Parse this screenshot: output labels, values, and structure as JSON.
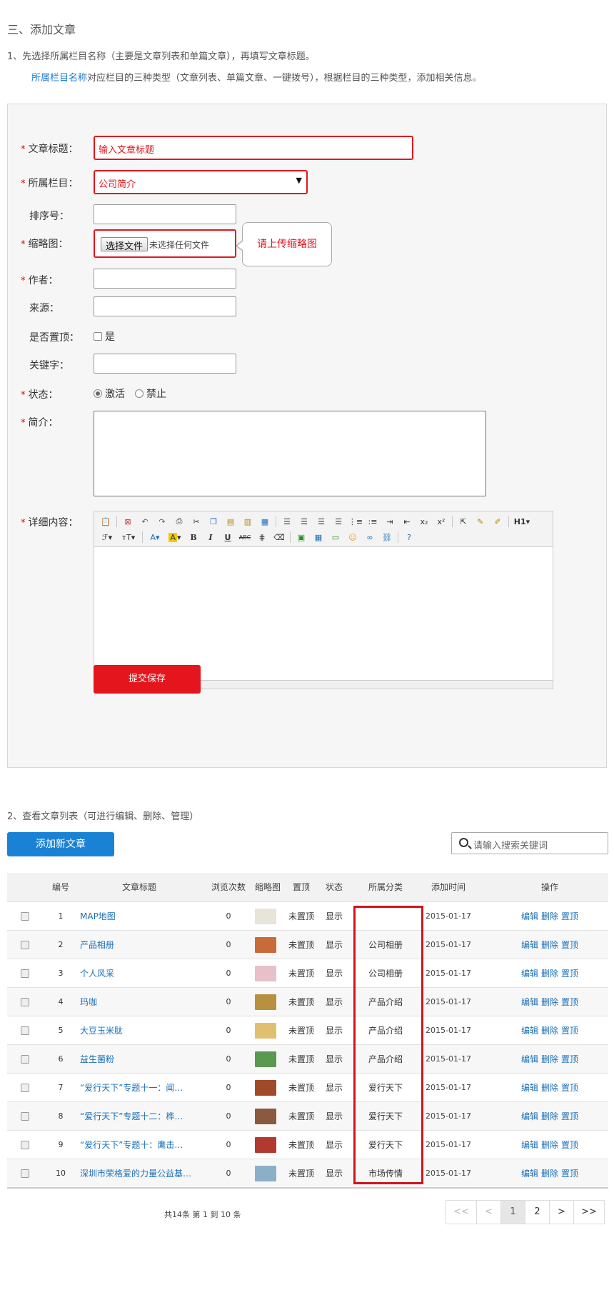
{
  "section_title": "三、添加文章",
  "step1": "1、先选择所属栏目名称（主要是文章列表和单篇文章），再填写文章标题。",
  "step1_note": {
    "highlight": "所属栏目名称",
    "rest": "对应栏目的三种类型（文章列表、单篇文章、一键拨号），根据栏目的三种类型，添加相关信息。"
  },
  "form": {
    "title_label": "文章标题：",
    "title_value": "输入文章标题",
    "column_label": "所属栏目：",
    "column_value": "公司简介",
    "order_label": "排序号：",
    "thumb_label": "缩略图：",
    "file_button": "选择文件",
    "file_status": "未选择任何文件",
    "thumb_tip": "请上传缩略图",
    "author_label": "作者：",
    "source_label": "来源：",
    "top_label": "是否置顶：",
    "top_option": "是",
    "keyword_label": "关键字：",
    "status_label": "状态：",
    "status_options": [
      "激活",
      "禁止"
    ],
    "status_selected": "激活",
    "intro_label": "简介：",
    "detail_label": "详细内容：",
    "submit_label": "提交保存",
    "required_mark": "*"
  },
  "editor": {
    "toolbar_row1": [
      "paste-icon",
      "source-icon",
      "undo-icon",
      "redo-icon",
      "print-icon",
      "cut-icon",
      "copy-icon",
      "paste-text-icon",
      "paste-word-icon",
      "paste-plain-icon",
      "align-left-icon",
      "align-center-icon",
      "align-right-icon",
      "align-justify-icon",
      "ordered-list-icon",
      "unordered-list-icon",
      "indent-icon",
      "outdent-icon",
      "subscript-icon",
      "superscript-icon",
      "select-all-icon",
      "clear-format-icon",
      "quick-format-icon",
      "heading-icon"
    ],
    "toolbar_row2": [
      "font-family-icon",
      "font-size-icon",
      "font-color-icon",
      "highlight-color-icon",
      "bold-icon",
      "italic-icon",
      "underline-icon",
      "strikethrough-icon",
      "line-height-icon",
      "eraser-icon",
      "image-icon",
      "table-icon",
      "hr-icon",
      "emoticon-icon",
      "link-icon",
      "unlink-icon",
      "help-icon"
    ],
    "heading_label": "H1",
    "glyphs": {
      "B": "B",
      "I": "I",
      "U": "U",
      "ABC": "ABC",
      "A": "A",
      "F": "ℱ",
      "T": "тT",
      "sub": "x₂",
      "sup": "x²"
    }
  },
  "step2": "2、查看文章列表（可进行编辑、删除、管理）",
  "add_button": "添加新文章",
  "search": {
    "placeholder": "请输入搜索关键词"
  },
  "table": {
    "headers": [
      "编号",
      "文章标题",
      "浏览次数",
      "缩略图",
      "置顶",
      "状态",
      "所属分类",
      "添加时间",
      "操作"
    ],
    "rows": [
      {
        "id": "1",
        "title": "MAP地图",
        "views": "0",
        "top": "未置顶",
        "status": "显示",
        "category": "",
        "date": "2015-01-17",
        "thumb_color": "#e8e4d8"
      },
      {
        "id": "2",
        "title": "产品相册",
        "views": "0",
        "top": "未置顶",
        "status": "显示",
        "category": "公司相册",
        "date": "2015-01-17",
        "thumb_color": "#c86a3a"
      },
      {
        "id": "3",
        "title": "个人风采",
        "views": "0",
        "top": "未置顶",
        "status": "显示",
        "category": "公司相册",
        "date": "2015-01-17",
        "thumb_color": "#e8c0c8"
      },
      {
        "id": "4",
        "title": "玛咖",
        "views": "0",
        "top": "未置顶",
        "status": "显示",
        "category": "产品介绍",
        "date": "2015-01-17",
        "thumb_color": "#b89040"
      },
      {
        "id": "5",
        "title": "大豆玉米肽",
        "views": "0",
        "top": "未置顶",
        "status": "显示",
        "category": "产品介绍",
        "date": "2015-01-17",
        "thumb_color": "#e0c070"
      },
      {
        "id": "6",
        "title": "益生菌粉",
        "views": "0",
        "top": "未置顶",
        "status": "显示",
        "category": "产品介绍",
        "date": "2015-01-17",
        "thumb_color": "#5a9a50"
      },
      {
        "id": "7",
        "title": "“爱行天下”专题十一：闻…",
        "views": "0",
        "top": "未置顶",
        "status": "显示",
        "category": "爱行天下",
        "date": "2015-01-17",
        "thumb_color": "#a04a2a"
      },
      {
        "id": "8",
        "title": "“爱行天下”专题十二：桦…",
        "views": "0",
        "top": "未置顶",
        "status": "显示",
        "category": "爱行天下",
        "date": "2015-01-17",
        "thumb_color": "#8a5a40"
      },
      {
        "id": "9",
        "title": "“爱行天下”专题十：鹰击…",
        "views": "0",
        "top": "未置顶",
        "status": "显示",
        "category": "爱行天下",
        "date": "2015-01-17",
        "thumb_color": "#b03a30"
      },
      {
        "id": "10",
        "title": "深圳市荣格爱的力量公益基…",
        "views": "0",
        "top": "未置顶",
        "status": "显示",
        "category": "市场传情",
        "date": "2015-01-17",
        "thumb_color": "#8ab0c8"
      }
    ],
    "ops": [
      "编辑",
      "删除",
      "置顶"
    ]
  },
  "pagination": {
    "info": "共14条   第 1 到 10 条",
    "first": "<<",
    "prev": "<",
    "pages": [
      "1",
      "2"
    ],
    "current": "1",
    "next": ">",
    "last": ">>"
  },
  "colors": {
    "accent_red": "#e4151c",
    "link_blue": "#1a6fb8",
    "button_blue": "#1a82d4"
  }
}
